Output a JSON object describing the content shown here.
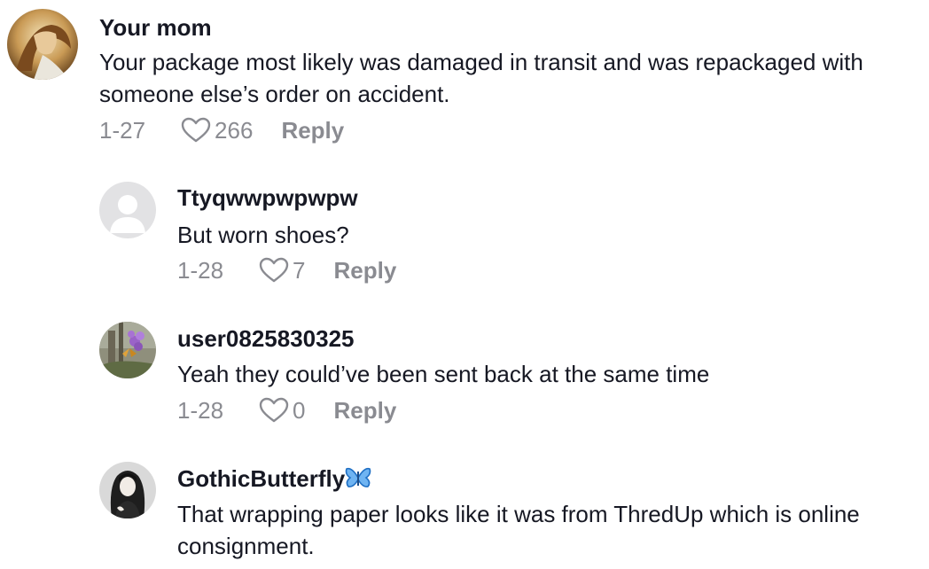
{
  "comments": [
    {
      "username": "Your mom",
      "text": "Your package most likely was damaged in transit and was repackaged with someone else’s order on accident.",
      "date": "1-27",
      "likes": "266",
      "reply_label": "Reply",
      "avatar": "user-avatar-illustration"
    },
    {
      "username": "Ttyqwwpwpwpw",
      "text": "But worn shoes?",
      "date": "1-28",
      "likes": "7",
      "reply_label": "Reply",
      "avatar": "default-avatar-icon"
    },
    {
      "username": "user0825830325",
      "text": "Yeah they could’ve been sent back at the same time",
      "date": "1-28",
      "likes": "0",
      "reply_label": "Reply",
      "avatar": "flower-photo-avatar"
    },
    {
      "username": "GothicButterfly",
      "username_emoji": "butterfly-emoji",
      "text": "That wrapping paper looks like it was from ThredUp which is online consignment.",
      "avatar": "person-photo-avatar"
    }
  ],
  "colors": {
    "text": "#161823",
    "meta": "#8a8b91",
    "background": "#ffffff",
    "butterfly": "#3a8ee6"
  }
}
